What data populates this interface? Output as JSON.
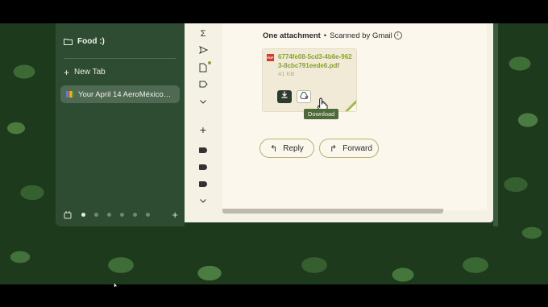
{
  "sidebar": {
    "folder_label": "Food :)",
    "new_tab_label": "New Tab",
    "active_tab_label": "Your April 14 AeroMéxico…",
    "space_dots": 6,
    "active_space_index": 0
  },
  "mail": {
    "attachment_heading": "One attachment",
    "scanned_label": "Scanned by Gmail",
    "attachment": {
      "type_badge": "PDF",
      "filename": "6774fe08-5cd3-4b6e-9623-8cbc791eede6.pdf",
      "size": "41 KB"
    },
    "tooltip": "Download",
    "reply_label": "Reply",
    "forward_label": "Forward"
  },
  "icons": {
    "rail": [
      "sigma-icon",
      "send-icon",
      "draft-icon",
      "label-icon",
      "chevron-down-icon",
      "plus-icon",
      "label-icon",
      "label-icon",
      "label-icon",
      "chevron-down-icon"
    ]
  },
  "colors": {
    "filename_accent": "#8aa332",
    "sidebar_bg": "#2e4c31",
    "tooltip_bg": "#4c6b37"
  }
}
